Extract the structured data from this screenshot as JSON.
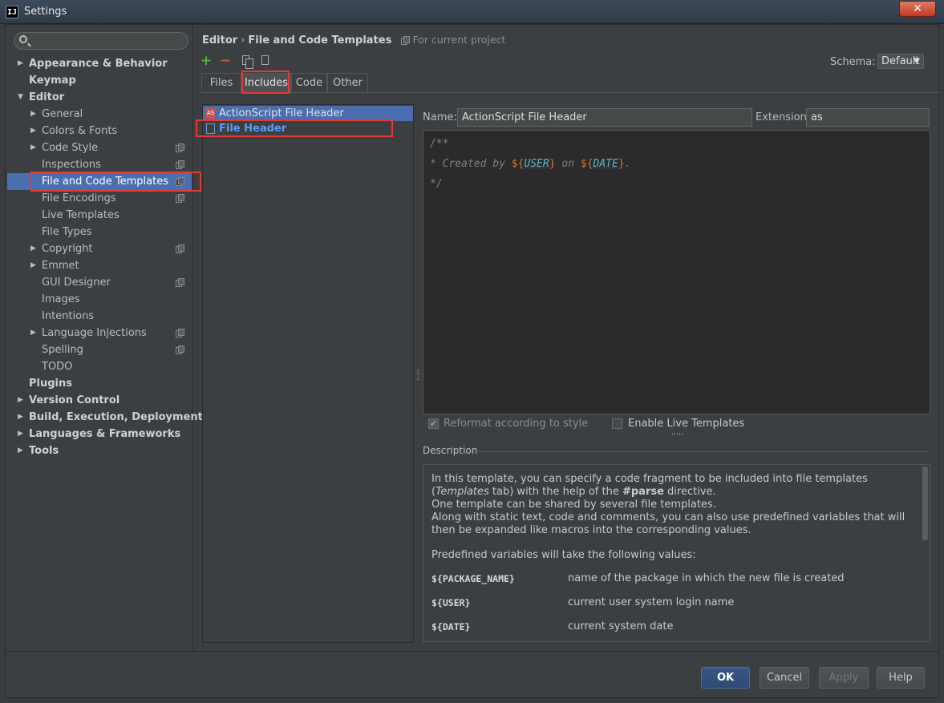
{
  "window": {
    "title": "Settings",
    "app_icon": "IJ"
  },
  "search": {
    "placeholder": ""
  },
  "sidebar": {
    "items": [
      {
        "label": "Appearance & Behavior",
        "level": 0,
        "arrow": "▶",
        "bold": true
      },
      {
        "label": "Keymap",
        "level": 0,
        "arrow": "",
        "bold": true
      },
      {
        "label": "Editor",
        "level": 0,
        "arrow": "▼",
        "bold": true
      },
      {
        "label": "General",
        "level": 1,
        "arrow": "▶"
      },
      {
        "label": "Colors & Fonts",
        "level": 1,
        "arrow": "▶"
      },
      {
        "label": "Code Style",
        "level": 1,
        "arrow": "▶",
        "project": true
      },
      {
        "label": "Inspections",
        "level": 1,
        "arrow": "",
        "project": true
      },
      {
        "label": "File and Code Templates",
        "level": 1,
        "arrow": "",
        "project": true,
        "selected": true
      },
      {
        "label": "File Encodings",
        "level": 1,
        "arrow": "",
        "project": true
      },
      {
        "label": "Live Templates",
        "level": 1,
        "arrow": ""
      },
      {
        "label": "File Types",
        "level": 1,
        "arrow": ""
      },
      {
        "label": "Copyright",
        "level": 1,
        "arrow": "▶",
        "project": true
      },
      {
        "label": "Emmet",
        "level": 1,
        "arrow": "▶"
      },
      {
        "label": "GUI Designer",
        "level": 1,
        "arrow": "",
        "project": true
      },
      {
        "label": "Images",
        "level": 1,
        "arrow": ""
      },
      {
        "label": "Intentions",
        "level": 1,
        "arrow": ""
      },
      {
        "label": "Language Injections",
        "level": 1,
        "arrow": "▶",
        "project": true
      },
      {
        "label": "Spelling",
        "level": 1,
        "arrow": "",
        "project": true
      },
      {
        "label": "TODO",
        "level": 1,
        "arrow": ""
      },
      {
        "label": "Plugins",
        "level": 0,
        "arrow": "",
        "bold": true
      },
      {
        "label": "Version Control",
        "level": 0,
        "arrow": "▶",
        "bold": true
      },
      {
        "label": "Build, Execution, Deployment",
        "level": 0,
        "arrow": "▶",
        "bold": true
      },
      {
        "label": "Languages & Frameworks",
        "level": 0,
        "arrow": "▶",
        "bold": true
      },
      {
        "label": "Tools",
        "level": 0,
        "arrow": "▶",
        "bold": true
      }
    ]
  },
  "breadcrumb": {
    "parent": "Editor",
    "separator": "›",
    "current": "File and Code Templates",
    "scope_note": "For current project"
  },
  "toolbar": {
    "add": "+",
    "remove": "−"
  },
  "schema": {
    "label": "Schema:",
    "value": "Default",
    "chevron": "▼"
  },
  "tabs": [
    {
      "label": "Files"
    },
    {
      "label": "Includes",
      "active": true
    },
    {
      "label": "Code"
    },
    {
      "label": "Other"
    }
  ],
  "templates": [
    {
      "label": "ActionScript File Header",
      "icon_text": "AS",
      "selected": true
    },
    {
      "label": "File Header",
      "icon_text": ""
    }
  ],
  "form": {
    "name_label": "Name:",
    "name_value": "ActionScript File Header",
    "extension_label": "Extension:",
    "extension_value": "as"
  },
  "editor": {
    "line1": "/**",
    "line2_prefix": "* Created by ",
    "var_user": "USER",
    "line2_mid": " on ",
    "var_date": "DATE",
    "line2_suffix": ".",
    "dollar": "$",
    "open_brace": "{",
    "close_brace": "}",
    "line3": "*/"
  },
  "options": {
    "reformat_label": "Reformat according to style",
    "reformat_checked": true,
    "live_templates_label": "Enable Live Templates",
    "live_templates_checked": false
  },
  "description": {
    "title": "Description",
    "p1_a": "In this template, you can specify a code fragment to be included into file templates (",
    "p1_em": "Templates",
    "p1_b": " tab) with the help of the ",
    "p1_strong": "#parse",
    "p1_c": " directive.",
    "p2": "One template can be shared by several file templates.",
    "p3": "Along with static text, code and comments, you can also use predefined variables that will then be expanded like macros into the corresponding values.",
    "p4": "Predefined variables will take the following values:",
    "variables": [
      {
        "name": "${PACKAGE_NAME}",
        "desc": "name of the package in which the new file is created"
      },
      {
        "name": "${USER}",
        "desc": "current user system login name"
      },
      {
        "name": "${DATE}",
        "desc": "current system date"
      }
    ]
  },
  "buttons": {
    "ok": "OK",
    "cancel": "Cancel",
    "apply": "Apply",
    "help": "Help"
  },
  "colors": {
    "selection": "#4b6eaf",
    "highlight": "#e53935",
    "accent_link": "#589df6"
  }
}
